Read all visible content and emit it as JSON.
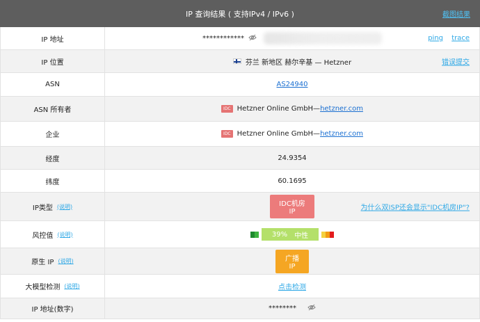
{
  "header": {
    "title": "IP 查询结果 ( 支持IPv4 / IPv6 )",
    "screenshot_link": "截图结果"
  },
  "rows": {
    "ip": {
      "label": "IP 地址",
      "value": "************",
      "ping": "ping",
      "trace": "trace"
    },
    "location": {
      "label": "IP 位置",
      "value": "芬兰 新地区 赫尔辛基 — Hetzner",
      "report": "错误提交"
    },
    "asn": {
      "label": "ASN",
      "value": "AS24940"
    },
    "asn_owner": {
      "label": "ASN 所有者",
      "badge": "IDC",
      "name": "Hetzner Online GmbH—",
      "domain": "hetzner.com"
    },
    "company": {
      "label": "企业",
      "badge": "IDC",
      "name": "Hetzner Online GmbH—",
      "domain": "hetzner.com"
    },
    "longitude": {
      "label": "经度",
      "value": "24.9354"
    },
    "latitude": {
      "label": "纬度",
      "value": "60.1695"
    },
    "ip_type": {
      "label": "IP类型",
      "explain": "(说明)",
      "value": "IDC机房IP",
      "question": "为什么双ISP还会显示\"IDC机房IP\"?"
    },
    "risk": {
      "label": "风控值",
      "explain": "(说明)",
      "percent": "39%",
      "level": "中性",
      "percent_value": 39
    },
    "native": {
      "label": "原生 IP",
      "explain": "(说明)",
      "value": "广播 IP"
    },
    "llm": {
      "label": "大模型检测",
      "explain": "(说明)",
      "value": "点击检测"
    },
    "ip_num": {
      "label": "IP 地址(数字)",
      "value": "********"
    }
  },
  "colors": {
    "header_bg": "#5e5e5e",
    "link_blue": "#2ea8e6",
    "idc_red": "#ec7b7b",
    "native_orange": "#f5a623",
    "risk_green": "#b4e06a"
  },
  "icons": {
    "hidden": "eye-slash-icon",
    "flag": "finland-flag-icon"
  }
}
